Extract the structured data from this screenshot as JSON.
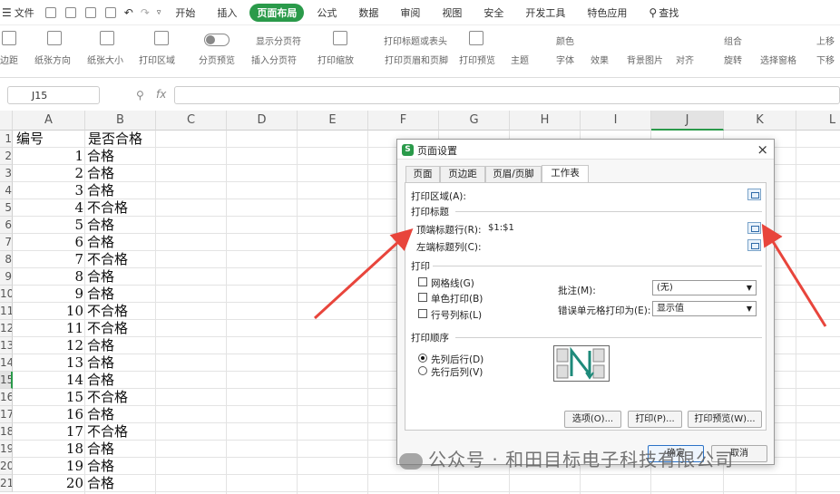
{
  "menu": {
    "file": "文件",
    "tabs": [
      "开始",
      "插入",
      "页面布局",
      "公式",
      "数据",
      "审阅",
      "视图",
      "安全",
      "开发工具",
      "特色应用"
    ],
    "active_tab": "页面布局",
    "search": "查找"
  },
  "ribbon": {
    "margins": "边距",
    "orientation": "纸张方向",
    "size": "纸张大小",
    "print_area": "打印区域",
    "page_break_preview": "分页预览",
    "show_page_breaks": "显示分页符",
    "insert_page_break": "插入分页符",
    "print_scale": "打印缩放",
    "print_titles": "打印标题或表头",
    "header_footer": "打印页眉和页脚",
    "print_preview": "打印预览",
    "theme": "主题",
    "colors": "颜色",
    "fonts": "字体",
    "effects": "效果",
    "background": "背景图片",
    "align": "对齐",
    "group": "组合",
    "rotate": "旋转",
    "selection_pane": "选择窗格",
    "bring_forward": "上移",
    "send_backward": "下移"
  },
  "formula_bar": {
    "cell_ref": "J15",
    "fx": "fx"
  },
  "sheet": {
    "columns": [
      "A",
      "B",
      "C",
      "D",
      "E",
      "F",
      "G",
      "H",
      "I",
      "J",
      "K",
      "L"
    ],
    "rows": [
      "1",
      "2",
      "3",
      "4",
      "5",
      "6",
      "7",
      "8",
      "9",
      "10",
      "11",
      "12",
      "13",
      "14",
      "15",
      "16",
      "17",
      "18",
      "19",
      "20",
      "21"
    ],
    "header": [
      "编号",
      "是否合格"
    ],
    "data": [
      [
        "1",
        "合格"
      ],
      [
        "2",
        "合格"
      ],
      [
        "3",
        "合格"
      ],
      [
        "4",
        "不合格"
      ],
      [
        "5",
        "合格"
      ],
      [
        "6",
        "合格"
      ],
      [
        "7",
        "不合格"
      ],
      [
        "8",
        "合格"
      ],
      [
        "9",
        "合格"
      ],
      [
        "10",
        "不合格"
      ],
      [
        "11",
        "不合格"
      ],
      [
        "12",
        "合格"
      ],
      [
        "13",
        "合格"
      ],
      [
        "14",
        "合格"
      ],
      [
        "15",
        "不合格"
      ],
      [
        "16",
        "合格"
      ],
      [
        "17",
        "不合格"
      ],
      [
        "18",
        "合格"
      ],
      [
        "19",
        "合格"
      ],
      [
        "20",
        "合格"
      ]
    ]
  },
  "dialog": {
    "title": "页面设置",
    "tabs": [
      "页面",
      "页边距",
      "页眉/页脚",
      "工作表"
    ],
    "active_tab": "工作表",
    "print_area_label": "打印区域(A):",
    "print_area_value": "",
    "print_titles_section": "打印标题",
    "top_rows_label": "顶端标题行(R):",
    "top_rows_value": "$1:$1",
    "left_cols_label": "左端标题列(C):",
    "left_cols_value": "",
    "print_section": "打印",
    "gridlines": "网格线(G)",
    "black_white": "单色打印(B)",
    "row_col_headings": "行号列标(L)",
    "comments_label": "批注(M):",
    "comments_value": "(无)",
    "errors_label": "错误单元格打印为(E):",
    "errors_value": "显示值",
    "order_section": "打印顺序",
    "down_then_over": "先列后行(D)",
    "over_then_down": "先行后列(V)",
    "options_btn": "选项(O)...",
    "print_btn": "打印(P)...",
    "preview_btn": "打印预览(W)...",
    "ok_btn": "确定",
    "cancel_btn": "取消"
  },
  "watermark": "公众号 · 和田目标电子科技有限公司",
  "colors": {
    "accent_green": "#2a9a4a",
    "arrow_red": "#e8453c"
  }
}
